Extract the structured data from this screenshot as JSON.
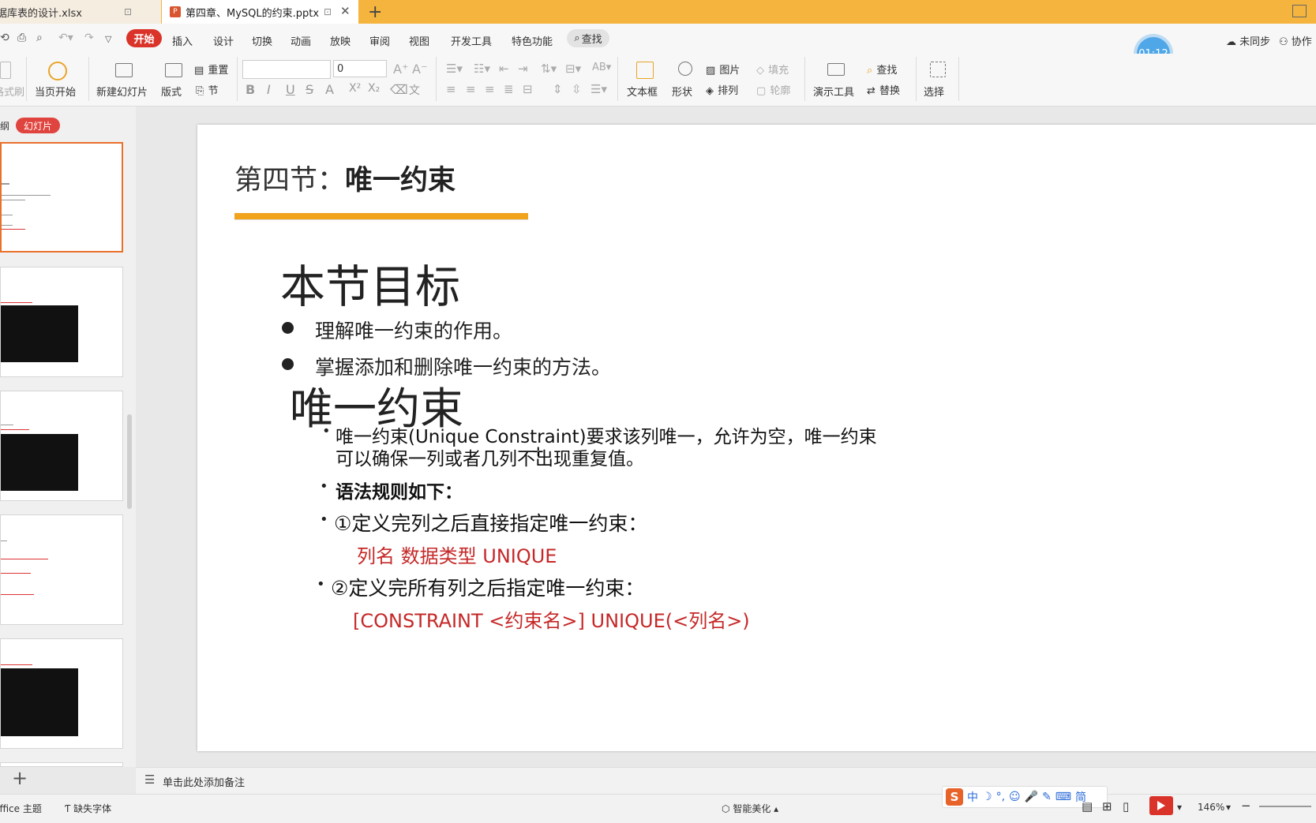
{
  "tabs": [
    {
      "label": "据库表的设计.xlsx",
      "pin": "⊡"
    },
    {
      "label": "第四章、MySQL的约束.pptx",
      "icon": "P",
      "pin": "⊡",
      "close": "✕"
    }
  ],
  "tab_add": "+",
  "menu": {
    "items": [
      "开始",
      "插入",
      "设计",
      "切换",
      "动画",
      "放映",
      "审阅",
      "视图",
      "开发工具",
      "特色功能"
    ],
    "search": "查找",
    "timer": "01:12",
    "sync": "未同步",
    "collab": "协作"
  },
  "ribbon": {
    "format_painter": "格式刷",
    "start_from_current": "当页开始",
    "new_slide": "新建幻灯片",
    "layout": "版式",
    "reset": "重置",
    "section": "节",
    "font_size": "0",
    "textbox": "文本框",
    "shape": "形状",
    "picture": "图片",
    "fill": "填充",
    "arrange": "排列",
    "outline": "轮廓",
    "present_tools": "演示工具",
    "find": "查找",
    "replace": "替换",
    "select": "选择",
    "format_buttons": [
      "B",
      "I",
      "U",
      "S",
      "A",
      "X²",
      "X₂"
    ]
  },
  "left_pane": {
    "outline_tab": "纲",
    "slides_tab": "幻灯片",
    "add_button": "+"
  },
  "slide": {
    "title_prefix": "第四节：",
    "title_bold": "唯一约束",
    "heading1": "本节目标",
    "goals": [
      "理解唯一约束的作用。",
      "掌握添加和删除唯一约束的方法。"
    ],
    "heading2": "唯一约束",
    "desc_line1": "唯一约束(Unique Constraint)要求该列唯一，允许为空，唯一约束",
    "desc_line2": "可以确保一列或者几列不出现重复值。",
    "syntax_heading": "语法规则如下：",
    "rule1": "①定义完列之后直接指定唯一约束：",
    "rule1_code": "列名  数据类型  UNIQUE",
    "rule2": "②定义完所有列之后指定唯一约束：",
    "rule2_code": "[CONSTRAINT <约束名>] UNIQUE(<列名>)",
    "bullet_char": "•"
  },
  "notes": {
    "placeholder": "单击此处添加备注"
  },
  "status": {
    "theme": "Office 主题",
    "missing_font": "缺失字体",
    "smart_beautify": "智能美化",
    "zoom": "146%",
    "ime_items": [
      "S",
      "中",
      "☽",
      "°,",
      "☺",
      "🎤",
      "✎",
      "⌨",
      "简"
    ]
  }
}
